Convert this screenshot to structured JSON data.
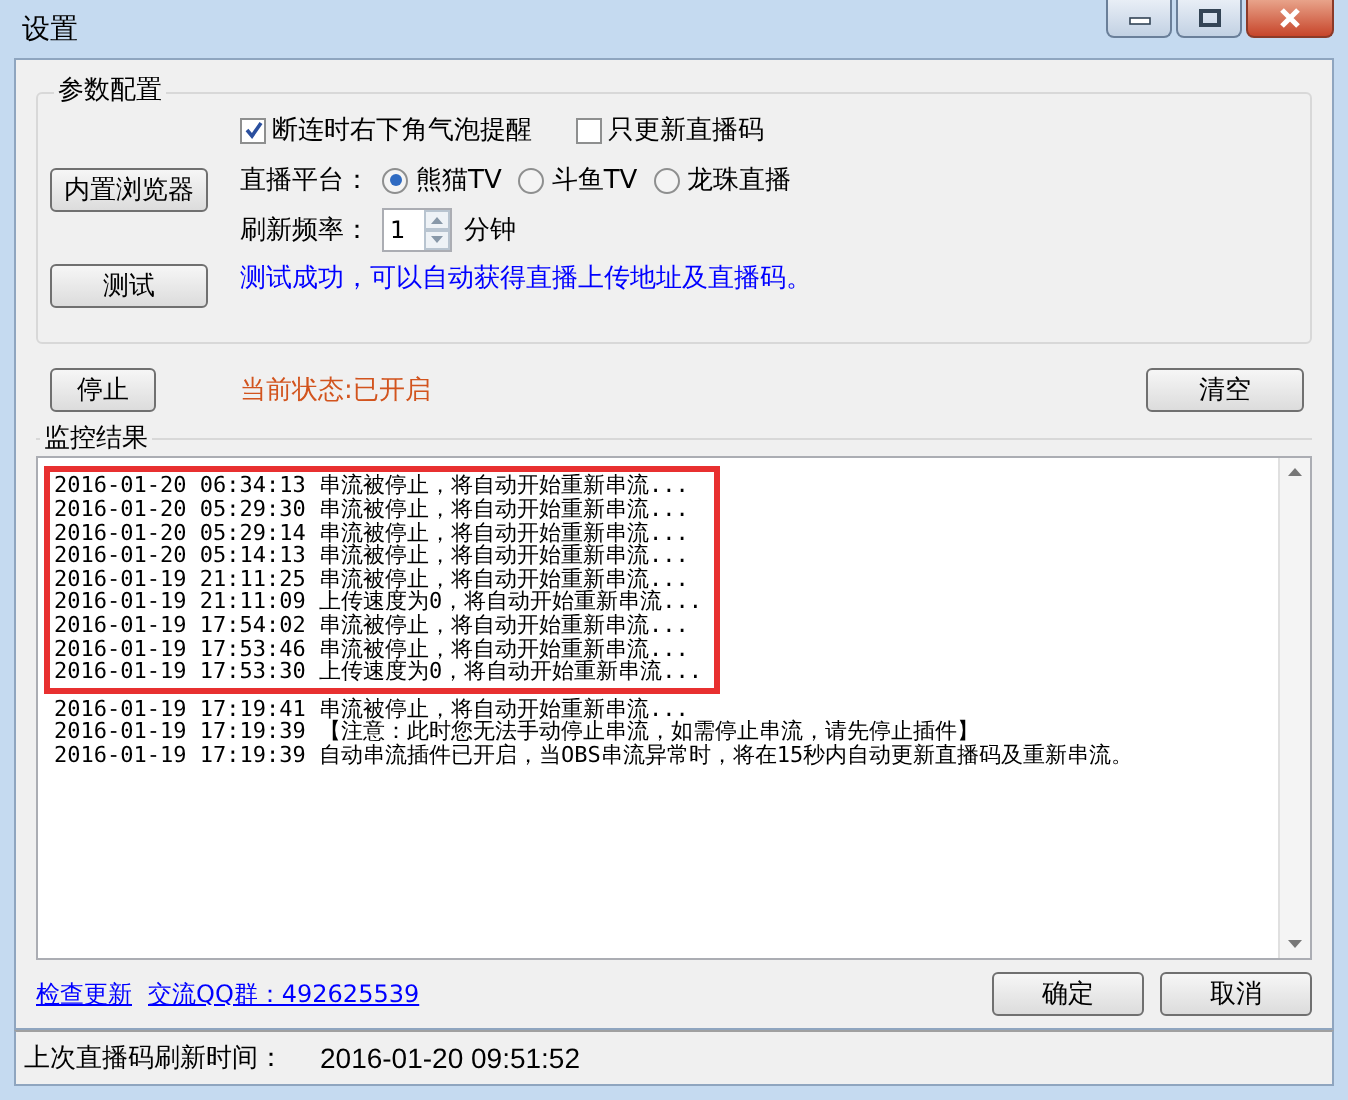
{
  "window": {
    "title": "设置"
  },
  "config": {
    "title": "参数配置",
    "buttons": [
      "内置浏览器",
      "测试"
    ],
    "options": [
      {
        "label": "断连时右下角气泡提醒",
        "checked": true
      },
      {
        "label": "只更新直播码",
        "checked": false
      }
    ],
    "platform_label": "直播平台：",
    "platforms": [
      {
        "label": "熊猫TV",
        "selected": true
      },
      {
        "label": "斗鱼TV",
        "selected": false
      },
      {
        "label": "龙珠直播",
        "selected": false
      }
    ],
    "refresh_label": "刷新频率：",
    "refresh_value": "1",
    "refresh_unit": "分钟",
    "message": "测试成功，可以自动获得直播上传地址及直播码。"
  },
  "stop_button": "停止",
  "status": "当前状态:已开启",
  "clear_button": "清空",
  "monitor": {
    "title": "监控结果",
    "lines": [
      {
        "text": "2016-01-20 06:34:13 串流被停止，将自动开始重新串流...",
        "highlighted": true
      },
      {
        "text": "2016-01-20 05:29:30 串流被停止，将自动开始重新串流...",
        "highlighted": true
      },
      {
        "text": "2016-01-20 05:29:14 串流被停止，将自动开始重新串流...",
        "highlighted": true
      },
      {
        "text": "2016-01-20 05:14:13 串流被停止，将自动开始重新串流...",
        "highlighted": true
      },
      {
        "text": "2016-01-19 21:11:25 串流被停止，将自动开始重新串流...",
        "highlighted": true
      },
      {
        "text": "2016-01-19 21:11:09 上传速度为0，将自动开始重新串流...",
        "highlighted": true
      },
      {
        "text": "2016-01-19 17:54:02 串流被停止，将自动开始重新串流...",
        "highlighted": true
      },
      {
        "text": "2016-01-19 17:53:46 串流被停止，将自动开始重新串流...",
        "highlighted": true
      },
      {
        "text": "2016-01-19 17:53:30 上传速度为0，将自动开始重新串流...",
        "highlighted": true
      },
      {
        "text": "2016-01-19 17:19:41 串流被停止，将自动开始重新串流...",
        "highlighted": false
      },
      {
        "text": "2016-01-19 17:19:39 【注意：此时您无法手动停止串流，如需停止串流，请先停止插件】",
        "highlighted": false
      },
      {
        "text": "2016-01-19 17:19:39 自动串流插件已开启，当OBS串流异常时，将在15秒内自动更新直播码及重新串流。",
        "highlighted": false
      }
    ]
  },
  "links": [
    "检查更新",
    "交流QQ群：492625539"
  ],
  "ok_button": "确定",
  "cancel_button": "取消",
  "status_bar": {
    "label": "上次直播码刷新时间：",
    "value": "2016-01-20 09:51:52"
  }
}
